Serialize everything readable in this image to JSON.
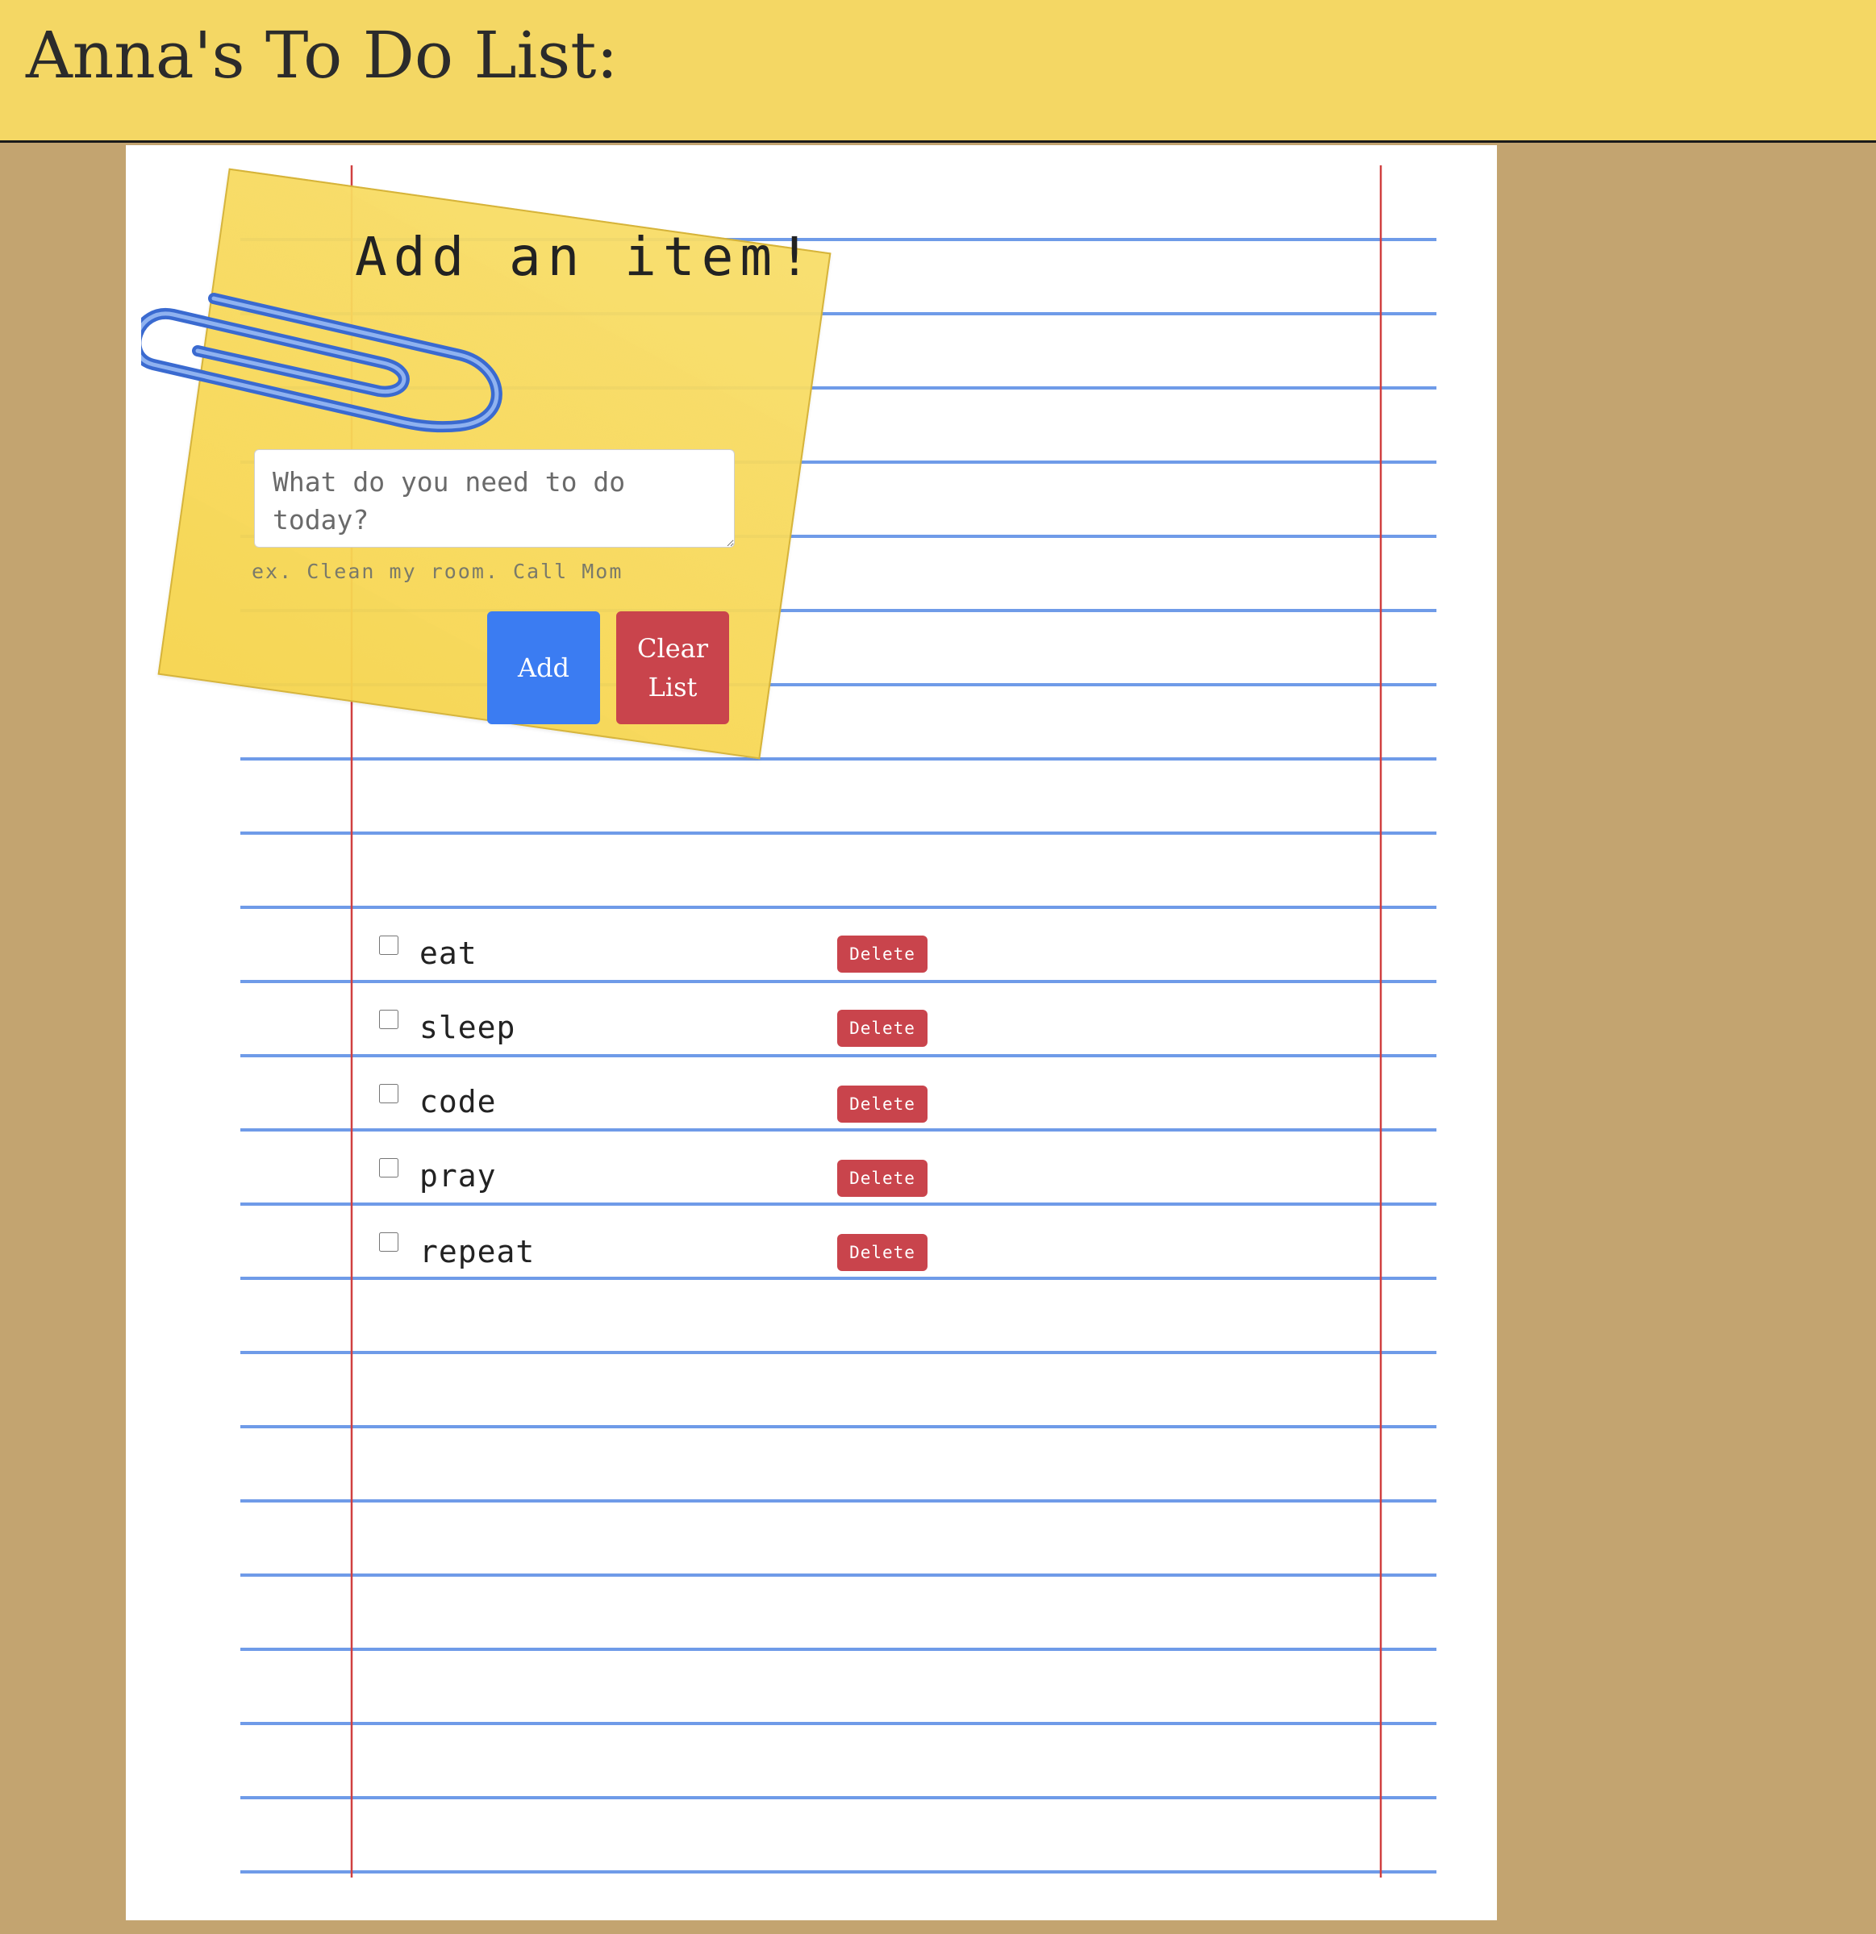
{
  "header": {
    "title": "Anna's To Do List:"
  },
  "form": {
    "title": "Add an item!",
    "input_placeholder": "What do you need to do today?",
    "hint": "ex. Clean my room. Call Mom",
    "add_label": "Add",
    "clear_label": "Clear List"
  },
  "items": [
    {
      "label": "eat",
      "checked": false,
      "delete_label": "Delete"
    },
    {
      "label": "sleep",
      "checked": false,
      "delete_label": "Delete"
    },
    {
      "label": "code",
      "checked": false,
      "delete_label": "Delete"
    },
    {
      "label": "pray",
      "checked": false,
      "delete_label": "Delete"
    },
    {
      "label": "repeat",
      "checked": false,
      "delete_label": "Delete"
    }
  ],
  "colors": {
    "background": "#c3a470",
    "header": "#f4d764",
    "paper_line": "#6f9be8",
    "margin_line": "#d04040",
    "sticky": "#f6d54c",
    "add_button": "#3b7cf2",
    "danger": "#c9444c"
  }
}
